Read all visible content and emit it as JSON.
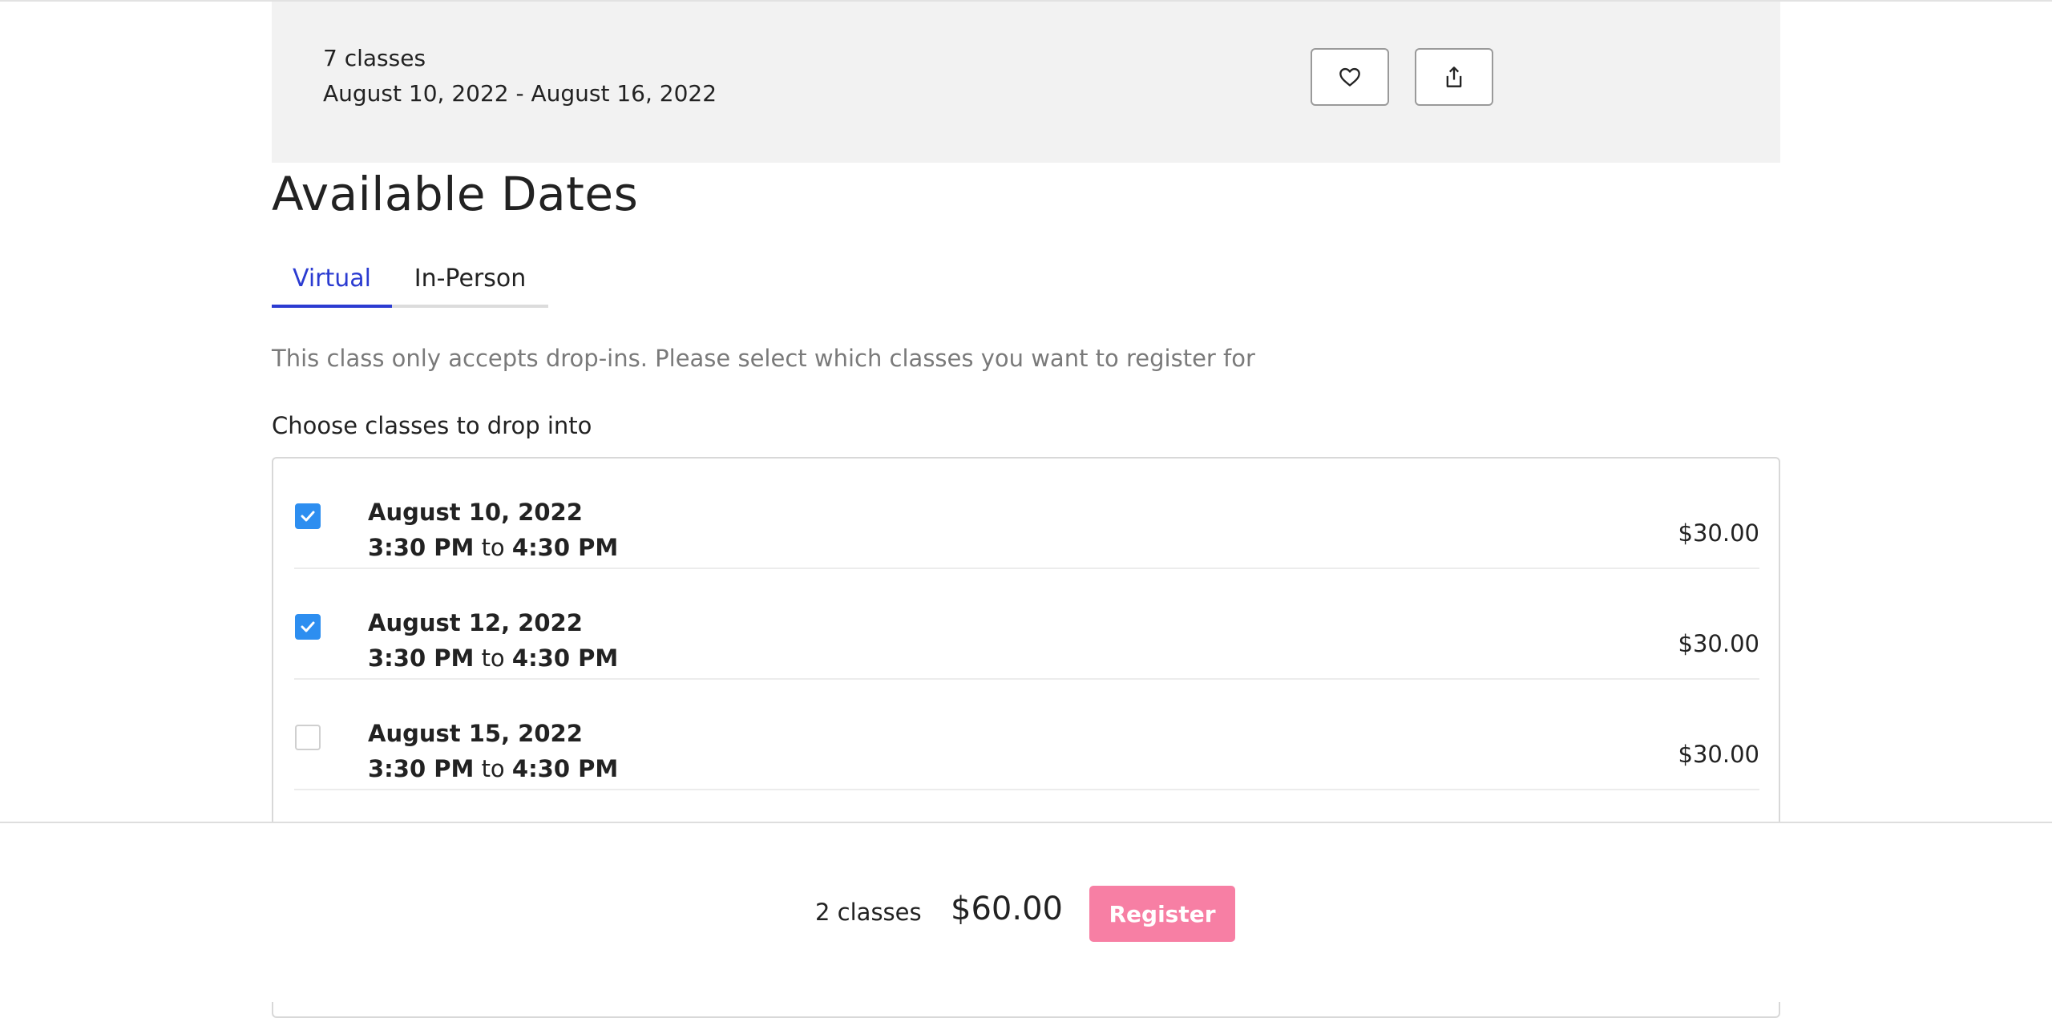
{
  "summary": {
    "count_text": "7 classes",
    "date_range": "August 10, 2022 - August 16, 2022",
    "favorite_icon": "heart-icon",
    "share_icon": "share-icon"
  },
  "heading": "Available Dates",
  "tabs": [
    {
      "label": "Virtual",
      "active": true
    },
    {
      "label": "In-Person",
      "active": false
    }
  ],
  "note": "This class only accepts drop-ins. Please select which classes you want to register for",
  "subheading": "Choose classes to drop into",
  "classes": [
    {
      "date": "August 10, 2022",
      "start": "3:30 PM",
      "connector": "to",
      "end": "4:30 PM",
      "price": "$30.00",
      "checked": true
    },
    {
      "date": "August 12, 2022",
      "start": "3:30 PM",
      "connector": "to",
      "end": "4:30 PM",
      "price": "$30.00",
      "checked": true
    },
    {
      "date": "August 15, 2022",
      "start": "3:30 PM",
      "connector": "to",
      "end": "4:30 PM",
      "price": "$30.00",
      "checked": false
    }
  ],
  "footer": {
    "selected_count": "2 classes",
    "total": "$60.00",
    "register_label": "Register"
  },
  "colors": {
    "accent": "#2b3bd1",
    "checkbox": "#2d8ef0",
    "register_button": "#f77fa4",
    "panel": "#f2f2f2"
  }
}
